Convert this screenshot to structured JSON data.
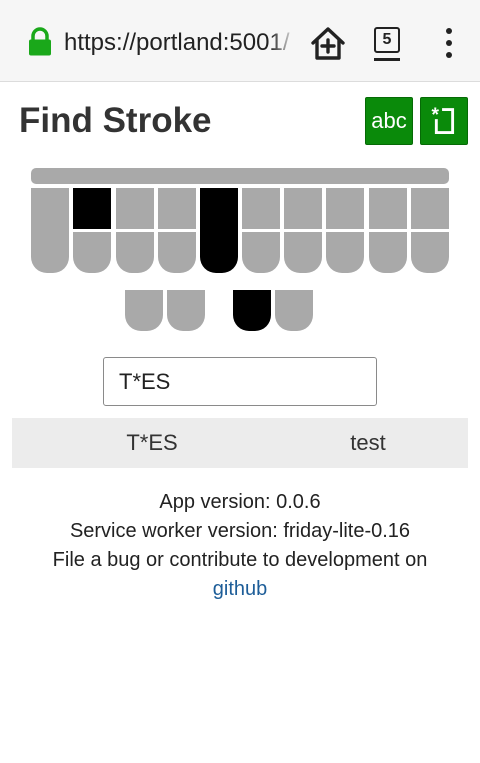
{
  "browser": {
    "url": "https://portland:5001/",
    "tab_count": "5",
    "secure": true
  },
  "header": {
    "title": "Find Stroke",
    "abc_label": "abc",
    "asterisk_icon": "asterisk-box-icon"
  },
  "steno": {
    "colors": {
      "off": "#a9a9a9",
      "on": "#000000",
      "accent": "#0a8a0a"
    },
    "number_bar": {
      "pressed": false
    },
    "left_keys": [
      {
        "key": "S",
        "pressed": false
      },
      {
        "key": "T",
        "pressed": true
      },
      {
        "key": "K",
        "pressed": false
      },
      {
        "key": "P",
        "pressed": false
      },
      {
        "key": "W",
        "pressed": false
      },
      {
        "key": "H",
        "pressed": false
      },
      {
        "key": "R",
        "pressed": false
      }
    ],
    "star": {
      "key": "*",
      "pressed": true
    },
    "right_keys": [
      {
        "key": "F",
        "pressed": false
      },
      {
        "key": "R",
        "pressed": false
      },
      {
        "key": "P",
        "pressed": false
      },
      {
        "key": "B",
        "pressed": false
      },
      {
        "key": "L",
        "pressed": false
      },
      {
        "key": "G",
        "pressed": false
      },
      {
        "key": "T",
        "pressed": false
      },
      {
        "key": "S",
        "pressed": false
      },
      {
        "key": "D",
        "pressed": false
      },
      {
        "key": "Z",
        "pressed": false
      }
    ],
    "vowels": [
      {
        "key": "A",
        "pressed": false
      },
      {
        "key": "O",
        "pressed": false
      },
      {
        "key": "E",
        "pressed": true
      },
      {
        "key": "U",
        "pressed": false
      }
    ]
  },
  "search": {
    "value": "T*ES"
  },
  "results": [
    {
      "stroke": "T*ES",
      "word": "test"
    }
  ],
  "footer": {
    "app_version": "App version: 0.0.6",
    "sw_version": "Service worker version: friday-lite-0.16",
    "contribute": "File a bug or contribute to development on",
    "link_text": "github"
  }
}
